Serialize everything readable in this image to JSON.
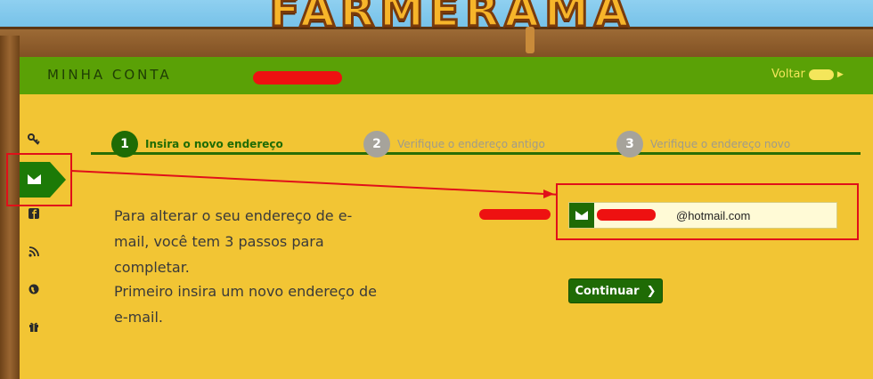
{
  "game": {
    "logo_text": "FARMERAMA"
  },
  "header": {
    "title": "MINHA CONTA",
    "back_label": "Voltar"
  },
  "sidebar": {
    "items": [
      {
        "icon": "key-icon",
        "glyph": "⚿"
      },
      {
        "icon": "envelope-icon",
        "active": true
      },
      {
        "icon": "facebook-icon",
        "glyph": "f"
      },
      {
        "icon": "rss-icon",
        "glyph": "◔"
      },
      {
        "icon": "globe-icon",
        "glyph": "●"
      },
      {
        "icon": "gift-icon",
        "glyph": "■"
      }
    ]
  },
  "steps": [
    {
      "num": "1",
      "label": "Insira o novo endereço",
      "active": true
    },
    {
      "num": "2",
      "label": "Verifique o endereço antigo",
      "active": false
    },
    {
      "num": "3",
      "label": "Verifique o endereço novo",
      "active": false
    }
  ],
  "content": {
    "para1": "Para alterar o seu endereço de e-mail, você tem 3 passos para completar.",
    "para2": "Primeiro insira um novo endereço de e-mail.",
    "email_value": "@hotmail.com",
    "continue_label": "Continuar",
    "continue_glyph": "❯"
  },
  "colors": {
    "header_green": "#5aa106",
    "panel_yellow": "#f2c534",
    "active_green": "#1f6b05",
    "annotation_red": "#e0101a"
  }
}
